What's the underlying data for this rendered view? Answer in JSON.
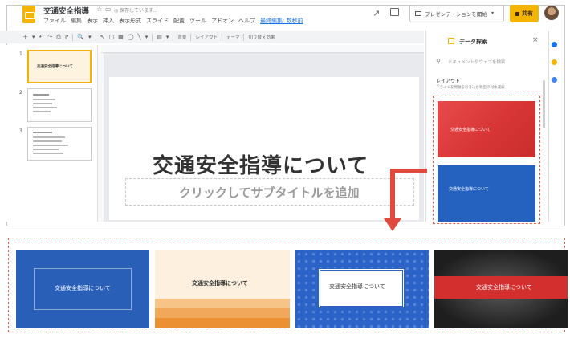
{
  "app": {
    "doc_title": "交通安全指導",
    "save_status": "◎ 保存しています...",
    "menu": [
      "ファイル",
      "編集",
      "表示",
      "挿入",
      "表示形式",
      "スライド",
      "配置",
      "ツール",
      "アドオン",
      "ヘルプ",
      "最終編集: 数秒前"
    ],
    "present_label": "プレゼンテーションを開始",
    "share_label": "共有"
  },
  "toolbar": {
    "icons": [
      "＋",
      "▾",
      "↶",
      "↷",
      "⎙",
      "⁋",
      "🔍",
      "▾",
      "↖",
      "▢",
      "▦",
      "◯",
      "╲",
      "▾",
      "▤",
      "▾"
    ],
    "background_label": "背景",
    "layout_label": "レイアウト",
    "theme_label": "テーマ",
    "transition_label": "切り替え効果"
  },
  "filmstrip": {
    "slides": [
      {
        "num": "1",
        "title": "交通安全指導について"
      },
      {
        "num": "2",
        "title": ""
      },
      {
        "num": "3",
        "title": ""
      }
    ]
  },
  "slide": {
    "title": "交通安全指導について",
    "subtitle_placeholder": "クリックしてサブタイトルを追加"
  },
  "panel": {
    "title": "データ探索",
    "search_placeholder": "ドキュメントやウェブを検索",
    "layout_label": "レイアウト",
    "layout_desc": "スライドを問題を引き込む新型の対象選択",
    "themes": [
      {
        "label": "交通安全指導について",
        "color": "#e23f3f"
      },
      {
        "label": "交通安全指導について",
        "color": "#2562c0"
      }
    ]
  },
  "gallery": {
    "themes": [
      {
        "label": "交通安全指導について",
        "style": "blue"
      },
      {
        "label": "交通安全指導について",
        "style": "orange"
      },
      {
        "label": "交通安全指導について",
        "style": "pattern"
      },
      {
        "label": "交通安全指導について",
        "style": "dark"
      }
    ]
  },
  "colors": {
    "accent": "#f4b400",
    "arrow": "#e04a3e",
    "blue_theme": "#2562c0",
    "red_theme": "#e23f3f"
  }
}
